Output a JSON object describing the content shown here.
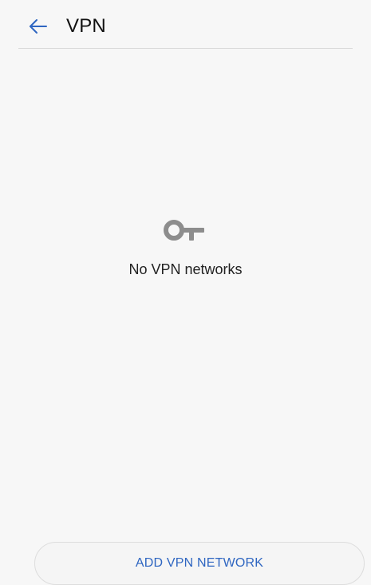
{
  "header": {
    "back_icon": "back-arrow-icon",
    "title": "VPN",
    "accent_color": "#2f66c1"
  },
  "empty_state": {
    "icon": "key-icon",
    "message": "No VPN networks"
  },
  "footer": {
    "add_button_label": "ADD VPN NETWORK"
  }
}
